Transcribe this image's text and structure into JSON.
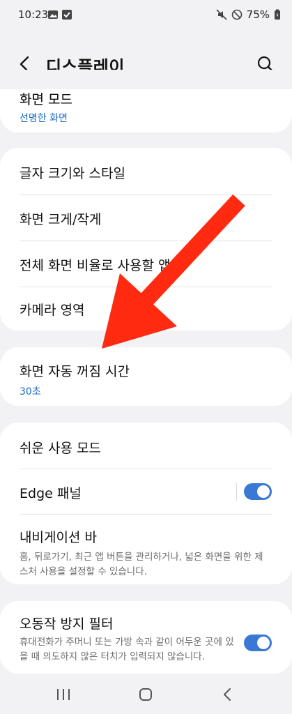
{
  "status": {
    "time": "10:23",
    "battery": "75%"
  },
  "header": {
    "title": "디스플레이"
  },
  "card1": {
    "label": "화면 모드",
    "value": "선명한 화면"
  },
  "card2": {
    "items": [
      "글자 크기와 스타일",
      "화면 크게/작게",
      "전체 화면 비율로 사용할 앱",
      "카메라 영역"
    ]
  },
  "card3": {
    "label": "화면 자동 꺼짐 시간",
    "value": "30초"
  },
  "card4": {
    "easy_mode": "쉬운 사용 모드",
    "edge_panel": "Edge 패널",
    "edge_panel_on": true,
    "nav_bar": "내비게이션 바",
    "nav_bar_desc": "홈, 뒤로가기, 최근 앱 버튼을 관리하거나, 넓은 화면을 위한 제스처 사용을 설정할 수 있습니다."
  },
  "card5": {
    "label": "오동작 방지 필터",
    "desc": "휴대전화가 주머니 또는 가방 속과 같이 어두운 곳에 있을 때 의도하지 않은 터치가 입력되지 않습니다.",
    "on": true
  },
  "colors": {
    "accent": "#3a78d6",
    "arrow": "#ff2a10",
    "link": "#1a6ac8"
  }
}
